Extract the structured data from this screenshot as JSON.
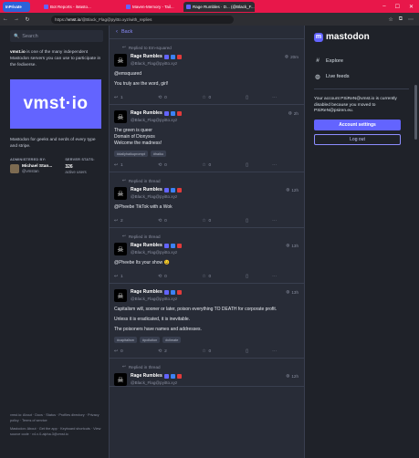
{
  "browser": {
    "tabs": [
      {
        "label": "InPrivate"
      },
      {
        "label": "Bot Reports - iMasto..."
      },
      {
        "label": "Maven-Memory - Tail..."
      },
      {
        "label": "Rage Rumbles · D... (@Black_F..."
      }
    ],
    "url_prefix": "https://",
    "url_domain": "vmst.io",
    "url_path": "/@Black_Flag@pyitto.xyz/with_replies"
  },
  "left": {
    "search_placeholder": "Search",
    "about_domain": "vmst.io",
    "about_text": " is one of the many independent Mastodon servers you can use to participate in the fediverse.",
    "hero_text": "vmst·io",
    "tagline": "Mastodon for geeks and nerds of every type and stripe.",
    "administered_by_label": "ADMINISTERED BY:",
    "server_stats_label": "SERVER STATS:",
    "admin_name": "Michael Stan...",
    "admin_handle": "@vmstan",
    "active_users_count": "326",
    "active_users_label": "active users",
    "footer_line1": "vmst.io: About · Docs · Status · Profiles directory · Privacy policy · Terms of service",
    "footer_line2": "Mastodon: About · Get the app · Keyboard shortcuts · View source code · v4.x.0-alpha.3@vmst.io"
  },
  "center": {
    "back_label": "Back",
    "posts": [
      {
        "context": "Replied to Em-squared",
        "name": "Rage Rumbles",
        "handle": "@Black_Flag@pyitto.xyz",
        "time": "20m",
        "paragraphs": [
          "@emsquared",
          "You truly are the word, girl!"
        ],
        "tags": [],
        "replies": "1",
        "boosts": "0",
        "favs": "0"
      },
      {
        "context": "",
        "name": "Rage Rumbles",
        "handle": "@Black_Flag@pyitto.xyz",
        "time": "2h",
        "paragraphs": [
          "The green is queer\nDomain of Dionysos\nWelcome the madness!"
        ],
        "tags": [
          "#dailyhaikuprompt",
          "#haiku"
        ],
        "replies": "1",
        "boosts": "0",
        "favs": "0"
      },
      {
        "context": "Replied in thread",
        "name": "Rage Rumbles",
        "handle": "@Black_Flag@pyitto.xyz",
        "time": "12h",
        "paragraphs": [
          "@Pheebe TikTok with a Wok"
        ],
        "tags": [],
        "replies": "2",
        "boosts": "0",
        "favs": "0"
      },
      {
        "context": "Replied in thread",
        "name": "Rage Rumbles",
        "handle": "@Black_Flag@pyitto.xyz",
        "time": "13h",
        "paragraphs": [
          "@Pheebe Its your show 😉"
        ],
        "tags": [],
        "replies": "1",
        "boosts": "0",
        "favs": "0"
      },
      {
        "context": "",
        "name": "Rage Rumbles",
        "handle": "@Black_Flag@pyitto.xyz",
        "time": "13h",
        "paragraphs": [
          "Capitalism will, sooner or later, poison everything TO DEATH for corporate profit.",
          "Unless it is eradicated, it is inevitable.",
          "The poisoners have names and addresses."
        ],
        "tags": [
          "#capitalism",
          "#pollution",
          "#climate"
        ],
        "replies": "0",
        "boosts": "2",
        "favs": "0"
      },
      {
        "context": "Replied in thread",
        "name": "Rage Rumbles",
        "handle": "@Black_Flag@pyitto.xyz",
        "time": "12h",
        "paragraphs": [],
        "tags": [],
        "replies": "",
        "boosts": "",
        "favs": ""
      }
    ]
  },
  "right": {
    "logo_text": "mastodon",
    "nav": [
      {
        "label": "Explore",
        "icon": "hashtag-icon"
      },
      {
        "label": "Live feeds",
        "icon": "globe-icon"
      }
    ],
    "notice": "Your account PSiReN@vmst.io is currently disabled because you moved to PSiReN@psiren.eu.",
    "account_settings_label": "Account settings",
    "logout_label": "Log out"
  },
  "colors": {
    "accent": "#6364ff",
    "tab_bar": "#e8174a",
    "column_bg": "#282c37",
    "page_bg": "#1f2229"
  }
}
